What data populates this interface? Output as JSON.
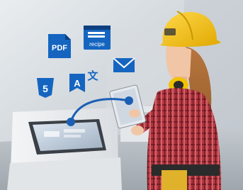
{
  "overlay_icons": {
    "pdf_label": "PDF",
    "recipe_label": "recipe",
    "html5_label": "5",
    "translate_latin": "A",
    "translate_glyph": "文"
  },
  "colors": {
    "icon_blue": "#1565c0",
    "connector_blue": "#1a5fb4",
    "hardhat_yellow": "#f2c200",
    "background_gray": "#cfd5db"
  }
}
